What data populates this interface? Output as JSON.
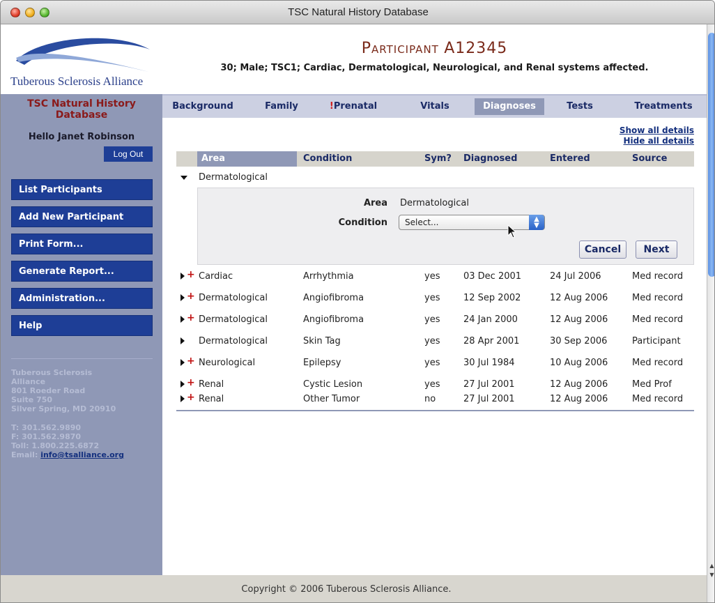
{
  "window": {
    "title": "TSC Natural History Database"
  },
  "header": {
    "logo_text": "Tuberous Sclerosis Alliance",
    "participant_prefix": "Participant",
    "participant_id": "A12345",
    "participant_summary": "30; Male; TSC1; Cardiac, Dermatological, Neurological, and Renal systems affected."
  },
  "sidebar": {
    "title_line1": "TSC Natural History",
    "title_line2": "Database",
    "greeting": "Hello Janet Robinson",
    "logout_label": "Log Out",
    "nav": [
      "List Participants",
      "Add New Participant",
      "Print Form...",
      "Generate Report...",
      "Administration...",
      "Help"
    ],
    "address": {
      "line1": "Tuberous Sclerosis",
      "line2": "Alliance",
      "line3": "801 Roeder Road",
      "line4": "Suite 750",
      "line5": "Silver Spring, MD 20910",
      "phone": "T: 301.562.9890",
      "fax": "F: 301.562.9870",
      "tollfree": "Toll: 1.800.225.6872",
      "email_label": "Email:",
      "email": "info@tsalliance.org"
    }
  },
  "tabs": [
    {
      "label": "Background"
    },
    {
      "label": "Family"
    },
    {
      "prefix": "!",
      "label": "Prenatal"
    },
    {
      "label": "Vitals"
    },
    {
      "label": "Diagnoses"
    },
    {
      "label": "Tests"
    },
    {
      "label": "Treatments"
    }
  ],
  "active_tab": "Diagnoses",
  "detail_links": {
    "show": "Show all details",
    "hide": "Hide all details"
  },
  "table": {
    "headers": [
      "Area",
      "Condition",
      "Sym?",
      "Diagnosed",
      "Entered",
      "Source"
    ],
    "expanded_row": {
      "area": "Dermatological"
    },
    "edit_panel": {
      "area_label": "Area",
      "area_value": "Dermatological",
      "condition_label": "Condition",
      "condition_selected": "Select...",
      "cancel_label": "Cancel",
      "next_label": "Next"
    },
    "rows": [
      {
        "area": "Cardiac",
        "condition": "Arrhythmia",
        "sym": "yes",
        "diagnosed": "03 Dec 2001",
        "entered": "24 Jul 2006",
        "source": "Med record",
        "has_plus": true
      },
      {
        "area": "Dermatological",
        "condition": "Angiofibroma",
        "sym": "yes",
        "diagnosed": "12 Sep 2002",
        "entered": "12 Aug 2006",
        "source": "Med record",
        "has_plus": true
      },
      {
        "area": "Dermatological",
        "condition": "Angiofibroma",
        "sym": "yes",
        "diagnosed": "24 Jan 2000",
        "entered": "12 Aug 2006",
        "source": "Med record",
        "has_plus": true
      },
      {
        "area": "Dermatological",
        "condition": "Skin Tag",
        "sym": "yes",
        "diagnosed": "28 Apr 2001",
        "entered": "30 Sep 2006",
        "source": "Participant",
        "has_plus": false
      },
      {
        "area": "Neurological",
        "condition": "Epilepsy",
        "sym": "yes",
        "diagnosed": "30 Jul 1984",
        "entered": "10 Aug 2006",
        "source": "Med record",
        "has_plus": true
      },
      {
        "area": "Renal",
        "condition": "Cystic Lesion",
        "sym": "yes",
        "diagnosed": "27 Jul 2001",
        "entered": "12 Aug 2006",
        "source": "Med Prof",
        "has_plus": true
      },
      {
        "area": "Renal",
        "condition": "Other Tumor",
        "sym": "no",
        "diagnosed": "27 Jul 2001",
        "entered": "12 Aug 2006",
        "source": "Med record",
        "has_plus": true
      }
    ]
  },
  "footer": {
    "copyright": "Copyright © 2006 Tuberous Sclerosis Alliance."
  },
  "colors": {
    "brand_blue": "#1e3e96",
    "sidebar": "#8f98b6",
    "title_red": "#8a1a1a",
    "participant_brown": "#7a2a1a"
  }
}
